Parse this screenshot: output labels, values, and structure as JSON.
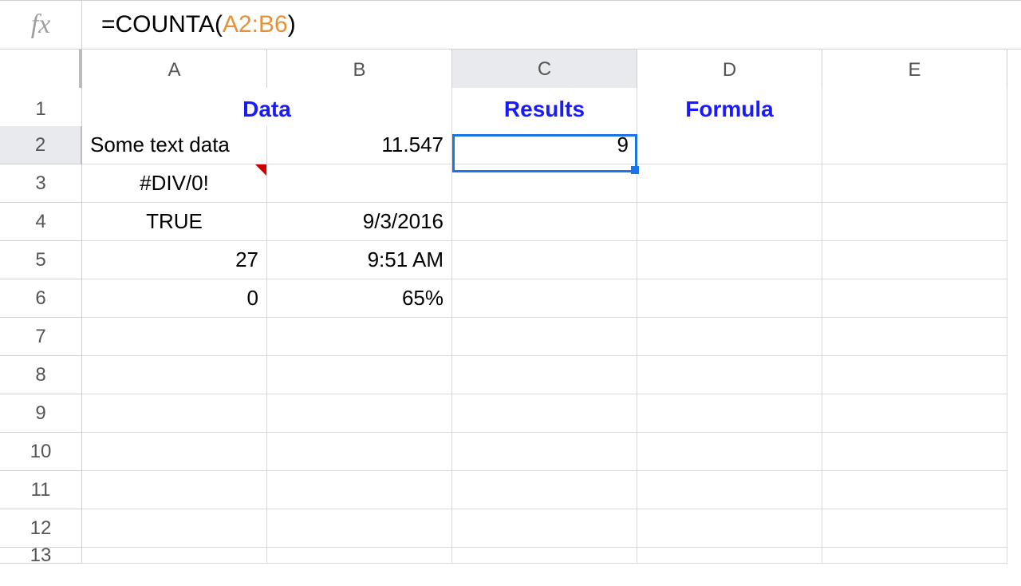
{
  "formula_bar": {
    "fx_label": "fx",
    "prefix": "=COUNTA(",
    "range": "A2:B6",
    "suffix": ")"
  },
  "columns": [
    "A",
    "B",
    "C",
    "D",
    "E"
  ],
  "rows": [
    "1",
    "2",
    "3",
    "4",
    "5",
    "6",
    "7",
    "8",
    "9",
    "10",
    "11",
    "12",
    "13"
  ],
  "selected": {
    "col": "C",
    "row": "2"
  },
  "cells": {
    "merged_AB1": "Data",
    "C1": "Results",
    "D1": "Formula",
    "A2": "Some text data",
    "B2": "11.547",
    "C2": "9",
    "A3": "#DIV/0!",
    "A4": "TRUE",
    "B4": "9/3/2016",
    "A5": "27",
    "B5": "9:51 AM",
    "A6": "0",
    "B6": "65%"
  }
}
